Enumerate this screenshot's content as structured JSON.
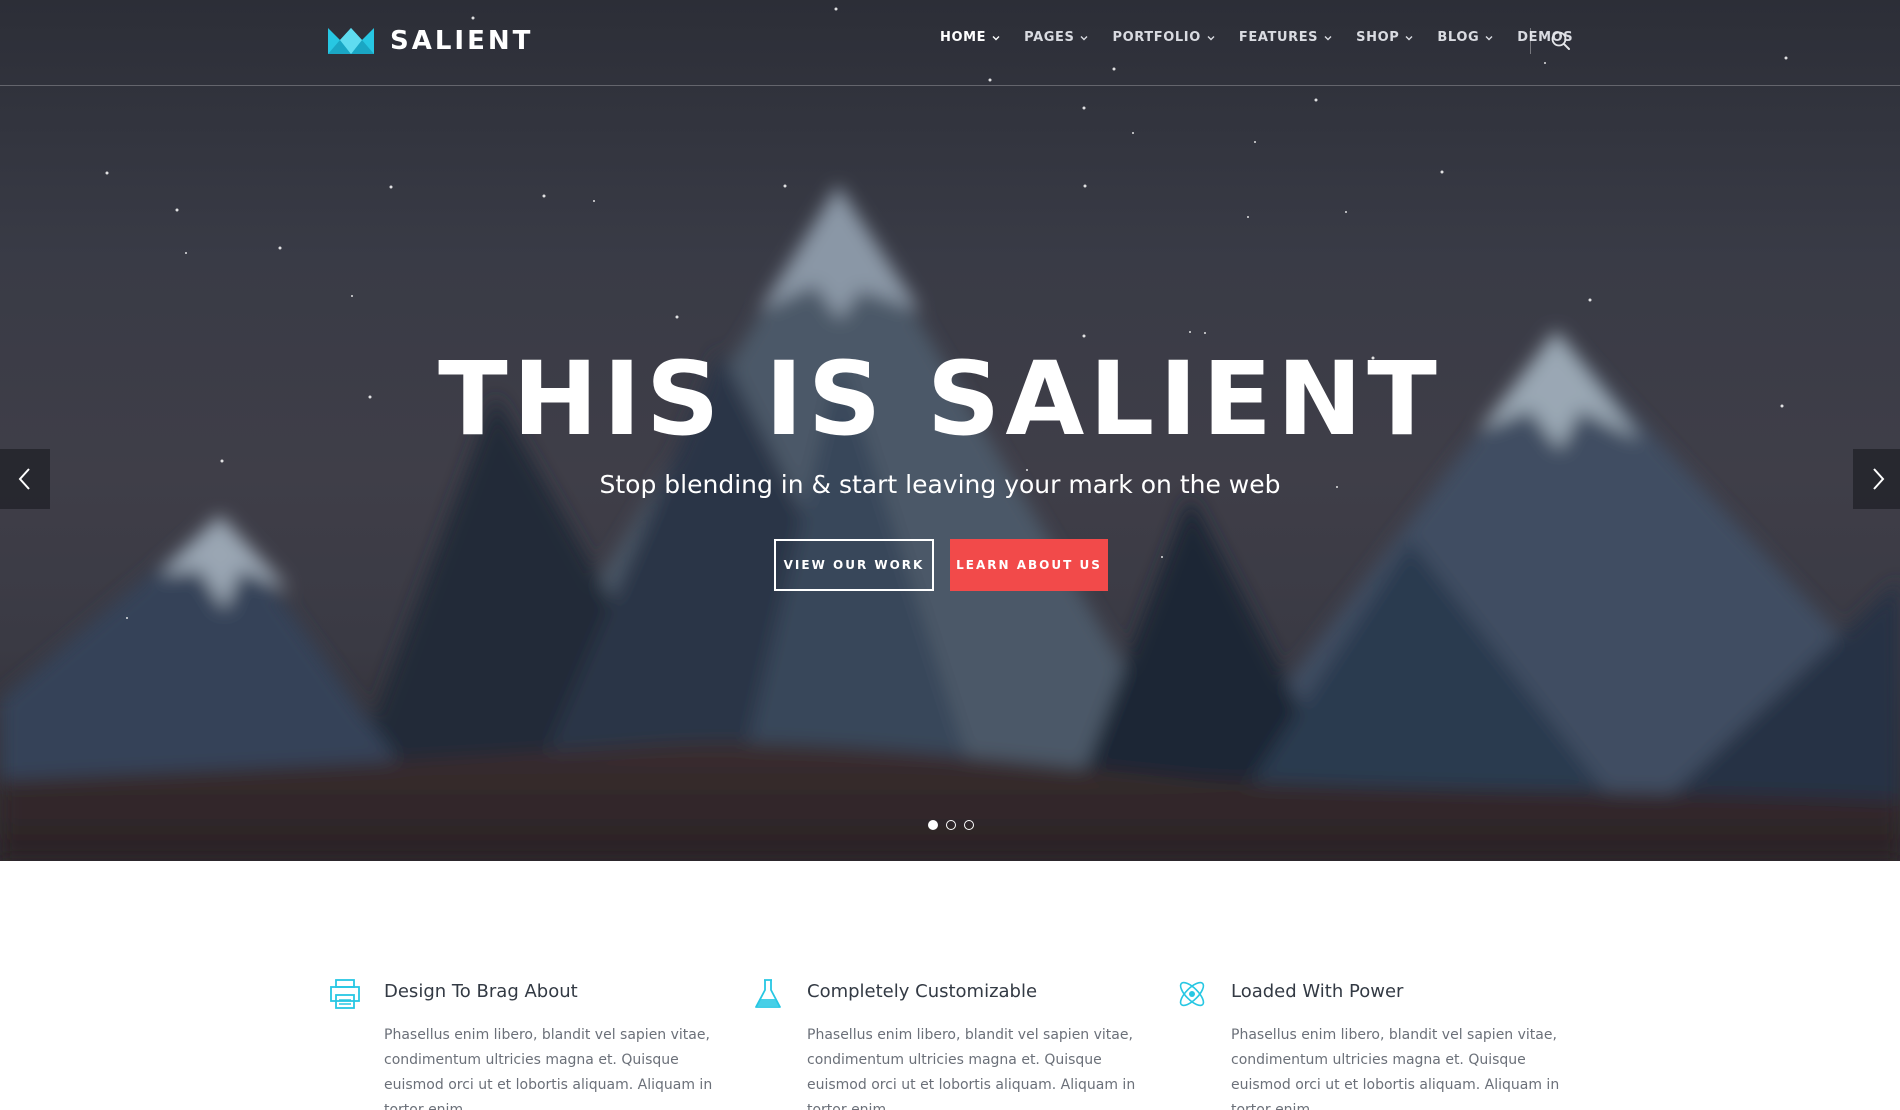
{
  "brand": {
    "name": "SALIENT",
    "accent": "#27c7e3"
  },
  "nav": {
    "items": [
      {
        "label": "HOME",
        "dropdown": true,
        "active": true
      },
      {
        "label": "PAGES",
        "dropdown": true
      },
      {
        "label": "PORTFOLIO",
        "dropdown": true
      },
      {
        "label": "FEATURES",
        "dropdown": true
      },
      {
        "label": "SHOP",
        "dropdown": true
      },
      {
        "label": "BLOG",
        "dropdown": true
      },
      {
        "label": "DEMOS",
        "dropdown": false
      }
    ],
    "search_icon": "search-icon"
  },
  "hero": {
    "title": "THIS IS SALIENT",
    "subtitle": "Stop blending in & start leaving your mark on the web",
    "primary_button": "VIEW OUR WORK",
    "secondary_button": "LEARN ABOUT US",
    "secondary_color": "#f24a4a",
    "slides": 3,
    "active_slide": 1,
    "prev_icon": "chevron-left-icon",
    "next_icon": "chevron-right-icon"
  },
  "features": [
    {
      "icon": "printer-icon",
      "title": "Design To Brag About",
      "body": "Phasellus enim libero, blandit vel sapien vitae, condimentum ultricies magna et. Quisque euismod orci ut et lobortis aliquam. Aliquam in tortor enim."
    },
    {
      "icon": "flask-icon",
      "title": "Completely Customizable",
      "body": "Phasellus enim libero, blandit vel sapien vitae, condimentum ultricies magna et. Quisque euismod orci ut et lobortis aliquam. Aliquam in tortor enim."
    },
    {
      "icon": "atom-icon",
      "title": "Loaded With Power",
      "body": "Phasellus enim libero, blandit vel sapien vitae, condimentum ultricies magna et. Quisque euismod orci ut et lobortis aliquam. Aliquam in tortor enim."
    }
  ]
}
